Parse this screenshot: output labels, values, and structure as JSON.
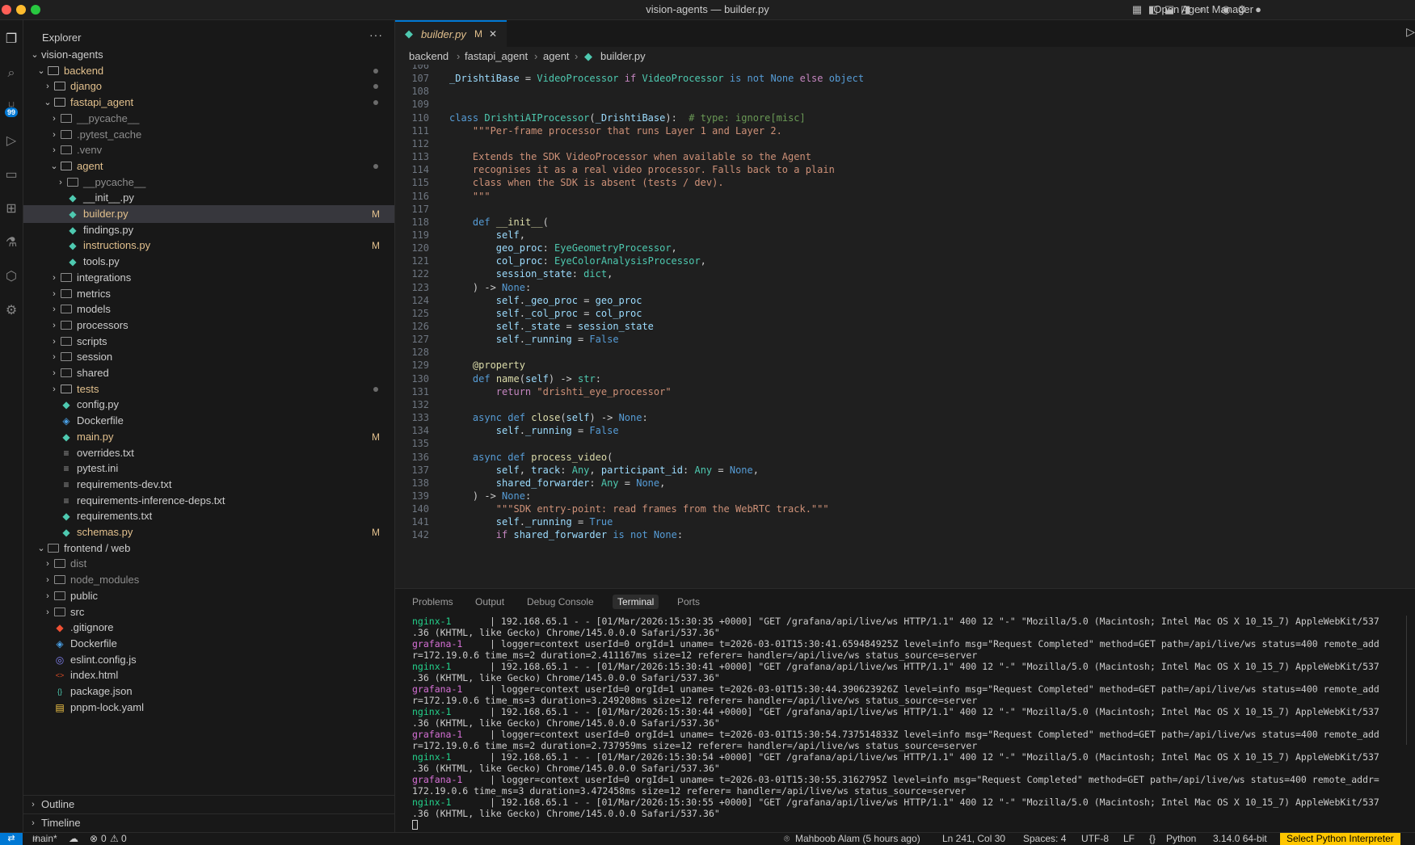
{
  "window": {
    "title": "vision-agents — builder.py",
    "agent_manager": "Open Agent Manager"
  },
  "activity_bar": {
    "items": [
      "files-icon",
      "search-icon",
      "source-control-icon",
      "run-debug-icon",
      "remote-explorer-icon",
      "extensions-icon",
      "testing-icon",
      "containers-icon",
      "settings-sync-icon"
    ],
    "scm_badge": "99"
  },
  "explorer": {
    "title": "Explorer",
    "more": "···",
    "tree": [
      {
        "label": "vision-agents",
        "type": "root",
        "depth": 0,
        "open": true
      },
      {
        "label": "backend",
        "type": "folder",
        "depth": 1,
        "open": true,
        "color": "#e2c08d",
        "dot": true
      },
      {
        "label": "django",
        "type": "folder",
        "depth": 2,
        "open": false,
        "color": "#e2c08d",
        "dot": true
      },
      {
        "label": "fastapi_agent",
        "type": "folder",
        "depth": 2,
        "open": true,
        "color": "#e2c08d",
        "dot": true
      },
      {
        "label": "__pycache__",
        "type": "folder",
        "depth": 3,
        "open": false,
        "color": "#8c8c8c"
      },
      {
        "label": ".pytest_cache",
        "type": "folder",
        "depth": 3,
        "open": false,
        "color": "#8c8c8c"
      },
      {
        "label": ".venv",
        "type": "folder",
        "depth": 3,
        "open": false,
        "color": "#8c8c8c"
      },
      {
        "label": "agent",
        "type": "folder",
        "depth": 3,
        "open": true,
        "color": "#e2c08d",
        "dot": true
      },
      {
        "label": "__pycache__",
        "type": "folder",
        "depth": 4,
        "open": false,
        "color": "#8c8c8c"
      },
      {
        "label": "__init__.py",
        "type": "py",
        "depth": 4,
        "color": "#cccccc"
      },
      {
        "label": "builder.py",
        "type": "py",
        "depth": 4,
        "color": "#e2c08d",
        "mark": "M",
        "selected": true
      },
      {
        "label": "findings.py",
        "type": "py",
        "depth": 4,
        "color": "#cccccc"
      },
      {
        "label": "instructions.py",
        "type": "py",
        "depth": 4,
        "color": "#e2c08d",
        "mark": "M"
      },
      {
        "label": "tools.py",
        "type": "py",
        "depth": 4,
        "color": "#cccccc"
      },
      {
        "label": "integrations",
        "type": "folder",
        "depth": 3,
        "open": false,
        "color": "#cccccc"
      },
      {
        "label": "metrics",
        "type": "folder",
        "depth": 3,
        "open": false,
        "color": "#cccccc"
      },
      {
        "label": "models",
        "type": "folder",
        "depth": 3,
        "open": false,
        "color": "#cccccc"
      },
      {
        "label": "processors",
        "type": "folder",
        "depth": 3,
        "open": false,
        "color": "#cccccc"
      },
      {
        "label": "scripts",
        "type": "folder",
        "depth": 3,
        "open": false,
        "color": "#cccccc"
      },
      {
        "label": "session",
        "type": "folder",
        "depth": 3,
        "open": false,
        "color": "#cccccc"
      },
      {
        "label": "shared",
        "type": "folder",
        "depth": 3,
        "open": false,
        "color": "#cccccc"
      },
      {
        "label": "tests",
        "type": "folder",
        "depth": 3,
        "open": false,
        "color": "#e2c08d",
        "dot": true
      },
      {
        "label": "config.py",
        "type": "py",
        "depth": 3,
        "color": "#cccccc"
      },
      {
        "label": "Dockerfile",
        "type": "docker",
        "depth": 3,
        "color": "#cccccc"
      },
      {
        "label": "main.py",
        "type": "py",
        "depth": 3,
        "color": "#e2c08d",
        "mark": "M"
      },
      {
        "label": "overrides.txt",
        "type": "txt",
        "depth": 3,
        "color": "#cccccc"
      },
      {
        "label": "pytest.ini",
        "type": "txt",
        "depth": 3,
        "color": "#cccccc"
      },
      {
        "label": "requirements-dev.txt",
        "type": "txt",
        "depth": 3,
        "color": "#cccccc"
      },
      {
        "label": "requirements-inference-deps.txt",
        "type": "txt",
        "depth": 3,
        "color": "#cccccc"
      },
      {
        "label": "requirements.txt",
        "type": "py",
        "depth": 3,
        "color": "#cccccc"
      },
      {
        "label": "schemas.py",
        "type": "py",
        "depth": 3,
        "color": "#e2c08d",
        "mark": "M"
      },
      {
        "label": "frontend / web",
        "type": "folder",
        "depth": 1,
        "open": true,
        "color": "#cccccc"
      },
      {
        "label": "dist",
        "type": "folder",
        "depth": 2,
        "open": false,
        "color": "#8c8c8c"
      },
      {
        "label": "node_modules",
        "type": "folder",
        "depth": 2,
        "open": false,
        "color": "#8c8c8c"
      },
      {
        "label": "public",
        "type": "folder",
        "depth": 2,
        "open": false,
        "color": "#cccccc"
      },
      {
        "label": "src",
        "type": "folder",
        "depth": 2,
        "open": false,
        "color": "#cccccc"
      },
      {
        "label": ".gitignore",
        "type": "git",
        "depth": 2,
        "color": "#cccccc"
      },
      {
        "label": "Dockerfile",
        "type": "docker",
        "depth": 2,
        "color": "#cccccc"
      },
      {
        "label": "eslint.config.js",
        "type": "eslint",
        "depth": 2,
        "color": "#cccccc"
      },
      {
        "label": "index.html",
        "type": "html",
        "depth": 2,
        "color": "#cccccc"
      },
      {
        "label": "package.json",
        "type": "json",
        "depth": 2,
        "color": "#cccccc"
      },
      {
        "label": "pnpm-lock.yaml",
        "type": "yaml",
        "depth": 2,
        "color": "#cccccc"
      }
    ],
    "outline": "Outline",
    "timeline": "Timeline"
  },
  "editor": {
    "tab": {
      "label": "builder.py",
      "modified": "M",
      "close": "✕"
    },
    "breadcrumb": [
      "backend",
      "fastapi_agent",
      "agent",
      "builder.py"
    ],
    "lines": [
      {
        "n": "106",
        "t": ""
      },
      {
        "n": "107",
        "t": "_DrishtiBase = VideoProcessor if VideoProcessor is not None else object"
      },
      {
        "n": "108",
        "t": ""
      },
      {
        "n": "109",
        "t": ""
      },
      {
        "n": "110",
        "t": "class DrishtiAIProcessor(_DrishtiBase):  # type: ignore[misc]"
      },
      {
        "n": "111",
        "t": "    \"\"\"Per-frame processor that runs Layer 1 and Layer 2."
      },
      {
        "n": "112",
        "t": ""
      },
      {
        "n": "113",
        "t": "    Extends the SDK VideoProcessor when available so the Agent"
      },
      {
        "n": "114",
        "t": "    recognises it as a real video processor. Falls back to a plain"
      },
      {
        "n": "115",
        "t": "    class when the SDK is absent (tests / dev)."
      },
      {
        "n": "116",
        "t": "    \"\"\""
      },
      {
        "n": "117",
        "t": ""
      },
      {
        "n": "118",
        "t": "    def __init__("
      },
      {
        "n": "119",
        "t": "        self,"
      },
      {
        "n": "120",
        "t": "        geo_proc: EyeGeometryProcessor,"
      },
      {
        "n": "121",
        "t": "        col_proc: EyeColorAnalysisProcessor,"
      },
      {
        "n": "122",
        "t": "        session_state: dict,"
      },
      {
        "n": "123",
        "t": "    ) -> None:"
      },
      {
        "n": "124",
        "t": "        self._geo_proc = geo_proc"
      },
      {
        "n": "125",
        "t": "        self._col_proc = col_proc"
      },
      {
        "n": "126",
        "t": "        self._state = session_state"
      },
      {
        "n": "127",
        "t": "        self._running = False"
      },
      {
        "n": "128",
        "t": ""
      },
      {
        "n": "129",
        "t": "    @property"
      },
      {
        "n": "130",
        "t": "    def name(self) -> str:"
      },
      {
        "n": "131",
        "t": "        return \"drishti_eye_processor\""
      },
      {
        "n": "132",
        "t": ""
      },
      {
        "n": "133",
        "t": "    async def close(self) -> None:"
      },
      {
        "n": "134",
        "t": "        self._running = False"
      },
      {
        "n": "135",
        "t": ""
      },
      {
        "n": "136",
        "t": "    async def process_video("
      },
      {
        "n": "137",
        "t": "        self, track: Any, participant_id: Any = None,"
      },
      {
        "n": "138",
        "t": "        shared_forwarder: Any = None,"
      },
      {
        "n": "139",
        "t": "    ) -> None:"
      },
      {
        "n": "140",
        "t": "        \"\"\"SDK entry-point: read frames from the WebRTC track.\"\"\""
      },
      {
        "n": "141",
        "t": "        self._running = True"
      },
      {
        "n": "142",
        "t": "        if shared_forwarder is not None:"
      }
    ]
  },
  "panel": {
    "tabs": [
      "Problems",
      "Output",
      "Debug Console",
      "Terminal",
      "Ports"
    ],
    "active_tab": "Terminal",
    "terminal": [
      {
        "src": "nginx-1",
        "text": "| 192.168.65.1 - - [01/Mar/2026:15:30:35 +0000] \"GET /grafana/api/live/ws HTTP/1.1\" 400 12 \"-\" \"Mozilla/5.0 (Macintosh; Intel Mac OS X 10_15_7) AppleWebKit/537"
      },
      {
        "src": "",
        "text": ".36 (KHTML, like Gecko) Chrome/145.0.0.0 Safari/537.36\""
      },
      {
        "src": "grafana-1",
        "text": "| logger=context userId=0 orgId=1 uname= t=2026-03-01T15:30:41.659484925Z level=info msg=\"Request Completed\" method=GET path=/api/live/ws status=400 remote_add"
      },
      {
        "src": "",
        "text": "r=172.19.0.6 time_ms=2 duration=2.411167ms size=12 referer= handler=/api/live/ws status_source=server"
      },
      {
        "src": "nginx-1",
        "text": "| 192.168.65.1 - - [01/Mar/2026:15:30:41 +0000] \"GET /grafana/api/live/ws HTTP/1.1\" 400 12 \"-\" \"Mozilla/5.0 (Macintosh; Intel Mac OS X 10_15_7) AppleWebKit/537"
      },
      {
        "src": "",
        "text": ".36 (KHTML, like Gecko) Chrome/145.0.0.0 Safari/537.36\""
      },
      {
        "src": "grafana-1",
        "text": "| logger=context userId=0 orgId=1 uname= t=2026-03-01T15:30:44.390623926Z level=info msg=\"Request Completed\" method=GET path=/api/live/ws status=400 remote_add"
      },
      {
        "src": "",
        "text": "r=172.19.0.6 time_ms=3 duration=3.249208ms size=12 referer= handler=/api/live/ws status_source=server"
      },
      {
        "src": "nginx-1",
        "text": "| 192.168.65.1 - - [01/Mar/2026:15:30:44 +0000] \"GET /grafana/api/live/ws HTTP/1.1\" 400 12 \"-\" \"Mozilla/5.0 (Macintosh; Intel Mac OS X 10_15_7) AppleWebKit/537"
      },
      {
        "src": "",
        "text": ".36 (KHTML, like Gecko) Chrome/145.0.0.0 Safari/537.36\""
      },
      {
        "src": "grafana-1",
        "text": "| logger=context userId=0 orgId=1 uname= t=2026-03-01T15:30:54.737514833Z level=info msg=\"Request Completed\" method=GET path=/api/live/ws status=400 remote_add"
      },
      {
        "src": "",
        "text": "r=172.19.0.6 time_ms=2 duration=2.737959ms size=12 referer= handler=/api/live/ws status_source=server"
      },
      {
        "src": "nginx-1",
        "text": "| 192.168.65.1 - - [01/Mar/2026:15:30:54 +0000] \"GET /grafana/api/live/ws HTTP/1.1\" 400 12 \"-\" \"Mozilla/5.0 (Macintosh; Intel Mac OS X 10_15_7) AppleWebKit/537"
      },
      {
        "src": "",
        "text": ".36 (KHTML, like Gecko) Chrome/145.0.0.0 Safari/537.36\""
      },
      {
        "src": "grafana-1",
        "text": "| logger=context userId=0 orgId=1 uname= t=2026-03-01T15:30:55.3162795Z level=info msg=\"Request Completed\" method=GET path=/api/live/ws status=400 remote_addr="
      },
      {
        "src": "",
        "text": "172.19.0.6 time_ms=3 duration=3.472458ms size=12 referer= handler=/api/live/ws status_source=server"
      },
      {
        "src": "nginx-1",
        "text": "| 192.168.65.1 - - [01/Mar/2026:15:30:55 +0000] \"GET /grafana/api/live/ws HTTP/1.1\" 400 12 \"-\" \"Mozilla/5.0 (Macintosh; Intel Mac OS X 10_15_7) AppleWebKit/537"
      },
      {
        "src": "",
        "text": ".36 (KHTML, like Gecko) Chrome/145.0.0.0 Safari/537.36\""
      }
    ]
  },
  "status_bar": {
    "branch": "main*",
    "errors": "0",
    "warnings": "0",
    "blame": "Mahboob Alam (5 hours ago)",
    "position": "Ln 241, Col 30",
    "spaces": "Spaces: 4",
    "encoding": "UTF-8",
    "eol": "LF",
    "language": "Python",
    "interpreter_version": "3.14.0 64-bit",
    "select_interpreter": "Select Python Interpreter"
  },
  "colors": {
    "accent": "#0078d4",
    "modified": "#e2c08d",
    "nginx": "#23d18b",
    "grafana": "#d670d6"
  }
}
